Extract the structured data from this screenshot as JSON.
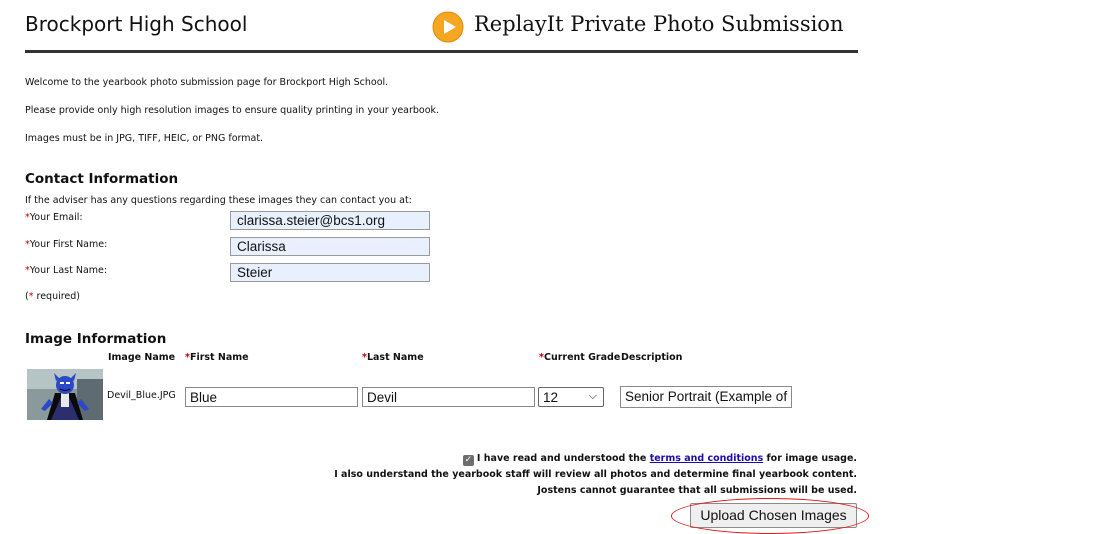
{
  "header": {
    "school_name": "Brockport High School",
    "logo_icon": "replay-play-icon",
    "logo_color": "#f5a623",
    "site_title": "ReplayIt Private Photo Submission"
  },
  "intro": {
    "line1": "Welcome to the yearbook photo submission page for Brockport High School.",
    "line2": "Please provide only high resolution images to ensure quality printing in your yearbook.",
    "line3": "Images must be in JPG, TIFF, HEIC, or PNG format."
  },
  "contact": {
    "heading": "Contact Information",
    "subtext": "If the adviser has any questions regarding these images they can contact you at:",
    "email_label": "Your Email:",
    "email_value": "clarissa.steier@bcs1.org",
    "first_label": "Your First Name:",
    "first_value": "Clarissa",
    "last_label": "Your Last Name:",
    "last_value": "Steier",
    "required_note": "required)"
  },
  "image_info": {
    "heading": "Image Information",
    "columns": {
      "image_name": "Image Name",
      "first_name": "First Name",
      "last_name": "Last Name",
      "grade": "Current Grade",
      "description": "Description"
    },
    "row": {
      "file_name": "Devil_Blue.JPG",
      "first_name": "Blue",
      "last_name": "Devil",
      "grade": "12",
      "description": "Senior Portrait (Example of"
    }
  },
  "agreement": {
    "checked": true,
    "line1_before": "I have read and understood the",
    "line1_link": "terms and conditions",
    "line1_after": "for image usage.",
    "line2": "I also understand the yearbook staff will review all photos and determine final yearbook content.",
    "line3": "Jostens cannot guarantee that all submissions will be used."
  },
  "upload_button_label": "Upload Chosen Images",
  "colors": {
    "required_marker": "#c00000",
    "autofill_bg": "#e8f0fe",
    "annotation_circle": "#e01b1b",
    "link": "#1a0dab"
  }
}
